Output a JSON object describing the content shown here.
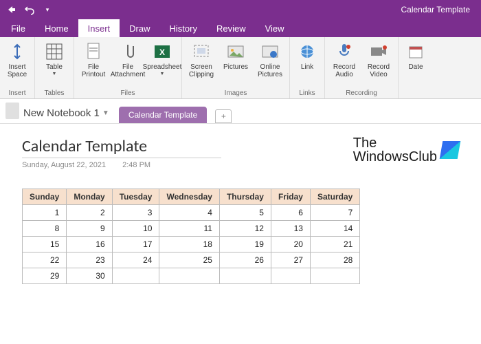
{
  "window": {
    "title": "Calendar Template"
  },
  "tabs": {
    "file": "File",
    "home": "Home",
    "insert": "Insert",
    "draw": "Draw",
    "history": "History",
    "review": "Review",
    "view": "View"
  },
  "ribbon": {
    "insert_space": "Insert\nSpace",
    "table": "Table",
    "file_printout": "File\nPrintout",
    "file_attachment": "File\nAttachment",
    "spreadsheet": "Spreadsheet",
    "screen_clipping": "Screen\nClipping",
    "pictures": "Pictures",
    "online_pictures": "Online\nPictures",
    "link": "Link",
    "record_audio": "Record\nAudio",
    "record_video": "Record\nVideo",
    "date": "Date",
    "g_insert": "Insert",
    "g_tables": "Tables",
    "g_files": "Files",
    "g_images": "Images",
    "g_links": "Links",
    "g_recording": "Recording"
  },
  "notebook": {
    "name": "New Notebook 1",
    "section": "Calendar Template",
    "add": "+"
  },
  "page": {
    "title": "Calendar Template",
    "date": "Sunday, August 22, 2021",
    "time": "2:48 PM",
    "brand1": "The",
    "brand2": "WindowsClub"
  },
  "calendar": {
    "headers": [
      "Sunday",
      "Monday",
      "Tuesday",
      "Wednesday",
      "Thursday",
      "Friday",
      "Saturday"
    ],
    "rows": [
      [
        "1",
        "2",
        "3",
        "4",
        "5",
        "6",
        "7"
      ],
      [
        "8",
        "9",
        "10",
        "11",
        "12",
        "13",
        "14"
      ],
      [
        "15",
        "16",
        "17",
        "18",
        "19",
        "20",
        "21"
      ],
      [
        "22",
        "23",
        "24",
        "25",
        "26",
        "27",
        "28"
      ],
      [
        "29",
        "30",
        "",
        "",
        "",
        "",
        ""
      ]
    ]
  }
}
